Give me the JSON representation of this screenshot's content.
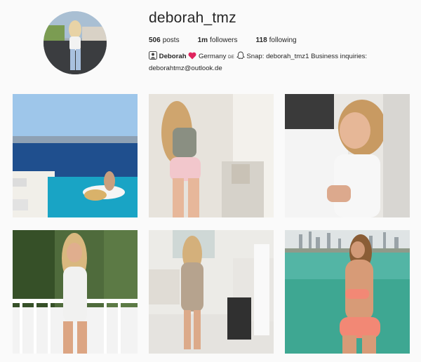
{
  "profile": {
    "username": "deborah_tmz",
    "stats": {
      "posts_value": "506",
      "posts_label": "posts",
      "followers_value": "1m",
      "followers_label": "followers",
      "following_value": "118",
      "following_label": "following"
    },
    "bio": {
      "name": "Deborah",
      "country": "Germany",
      "flag_text": "DE",
      "snap": "Snap: deborah_tmz1",
      "business": "Business inquiries:",
      "email": "deborahtmz@outlook.de"
    },
    "icons": {
      "name_icon": "person-icon",
      "heart_icon": "heart-icon",
      "snap_icon": "ghost-icon"
    },
    "colors": {
      "heart": "#e0245e",
      "text": "#262626",
      "background": "#fafafa"
    }
  },
  "posts": [
    {
      "id": "post-1",
      "description_icon": "photo-icon"
    },
    {
      "id": "post-2",
      "description_icon": "photo-icon"
    },
    {
      "id": "post-3",
      "description_icon": "photo-icon"
    },
    {
      "id": "post-4",
      "description_icon": "photo-icon"
    },
    {
      "id": "post-5",
      "description_icon": "photo-icon"
    },
    {
      "id": "post-6",
      "description_icon": "photo-icon"
    }
  ]
}
